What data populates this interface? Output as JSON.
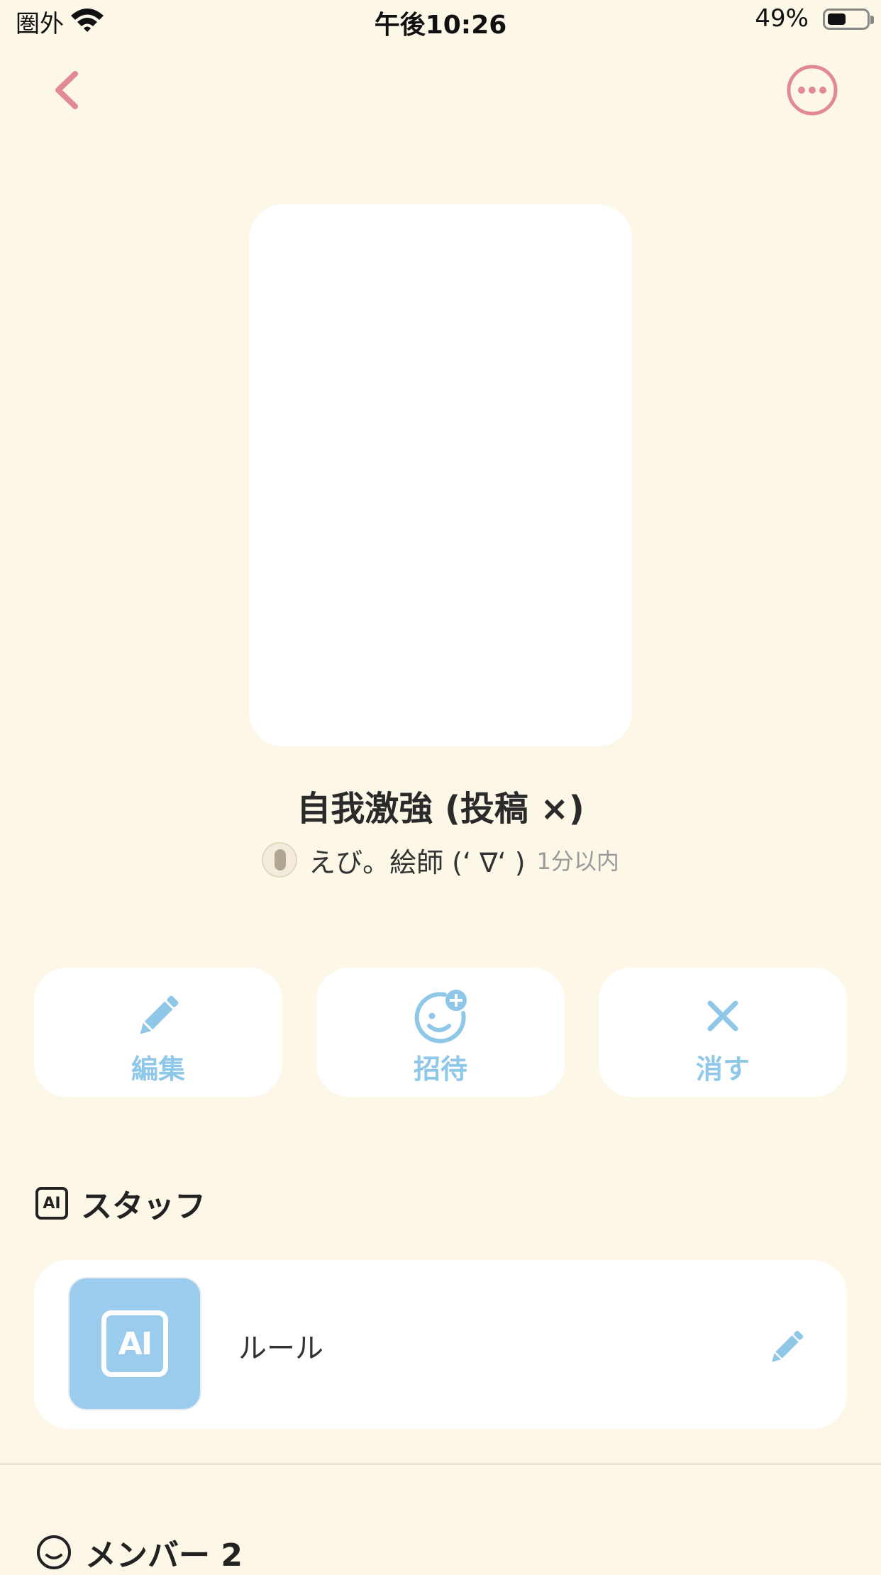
{
  "status_bar": {
    "carrier": "圏外",
    "time": "午後10:26",
    "battery_percent": "49%",
    "battery_level": 0.49
  },
  "nav": {
    "back_icon": "chevron-left-icon",
    "more_icon": "more-horizontal-circle-icon",
    "accent_color": "#e28a93"
  },
  "room": {
    "title": "自我激強 (投稿 ×)",
    "author_name": "えび。絵師 (‘ ∇‘ )",
    "updated": "1分以内"
  },
  "actions": [
    {
      "label": "編集",
      "icon": "pencil-icon"
    },
    {
      "label": "招待",
      "icon": "invite-smile-plus-icon"
    },
    {
      "label": "消す",
      "icon": "close-icon"
    }
  ],
  "staff_section": {
    "title": "スタッフ",
    "icon_text": "AI",
    "items": [
      {
        "name": "ルール",
        "avatar_text": "AI",
        "avatar_color": "#9bcbed"
      }
    ]
  },
  "members_section": {
    "title": "メンバー 2"
  },
  "colors": {
    "background": "#fdf7e8",
    "card": "#ffffff",
    "action_blue": "#8fc7e9"
  }
}
